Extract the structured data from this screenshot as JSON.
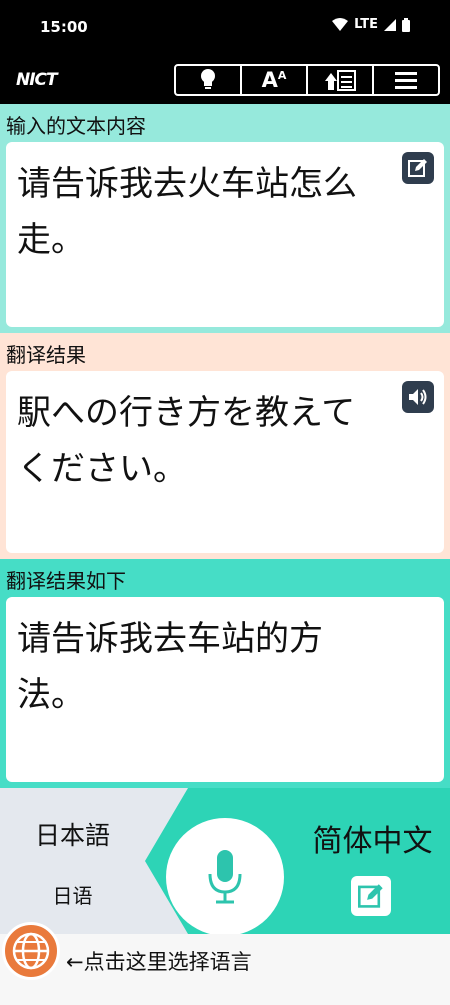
{
  "status_bar": {
    "time": "15:00",
    "network": "LTE"
  },
  "header": {
    "logo_text": "NICT"
  },
  "toolbar": {
    "items": [
      {
        "icon": "lightbulb-icon"
      },
      {
        "icon": "font-size-icon"
      },
      {
        "icon": "upload-list-icon"
      },
      {
        "icon": "menu-icon"
      }
    ],
    "font_size_label": "A",
    "font_size_sup": "A"
  },
  "input_section": {
    "label": "输入的文本内容",
    "text": "请告诉我去火车站怎么走。",
    "icon": "edit-icon"
  },
  "result_section": {
    "label": "翻译结果",
    "text": "駅への行き方を教えてください。",
    "icon": "speaker-icon"
  },
  "back_section": {
    "label": "翻译结果如下",
    "text": "请告诉我去车站的方法。"
  },
  "language_bar": {
    "source_language": "日本語",
    "source_language_sub": "日语",
    "target_language": "简体中文",
    "mic_icon": "microphone-icon",
    "edit_icon": "edit-icon"
  },
  "footer": {
    "text": "←点击这里选择语言",
    "icon": "globe-icon"
  },
  "colors": {
    "input_bg": "#96e9dc",
    "result_bg": "#ffe4d6",
    "back_bg": "#46ddc6",
    "accent": "#2dd4b6",
    "globe": "#e97a3c"
  }
}
